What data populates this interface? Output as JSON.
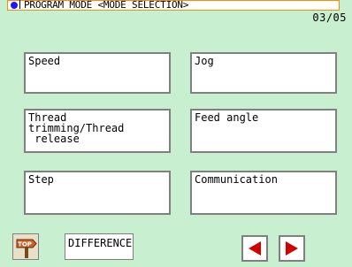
{
  "header": {
    "title": "PROGRAM MODE <MODE SELECTION>",
    "page": "03/05"
  },
  "modes": [
    {
      "label": "Speed"
    },
    {
      "label": "Jog"
    },
    {
      "label": "Thread trimming/Thread\n release"
    },
    {
      "label": "Feed angle"
    },
    {
      "label": "Step"
    },
    {
      "label": "Communication"
    }
  ],
  "footer": {
    "top_label": "TOP",
    "difference_label": "DIFFERENCE"
  },
  "colors": {
    "background": "#c8f0d0",
    "header_border": "#ff8c00",
    "dot": "#1a1aff",
    "arrow": "#d00000"
  },
  "icons": [
    "status-dot-icon",
    "top-icon",
    "left-arrow-icon",
    "right-arrow-icon"
  ]
}
